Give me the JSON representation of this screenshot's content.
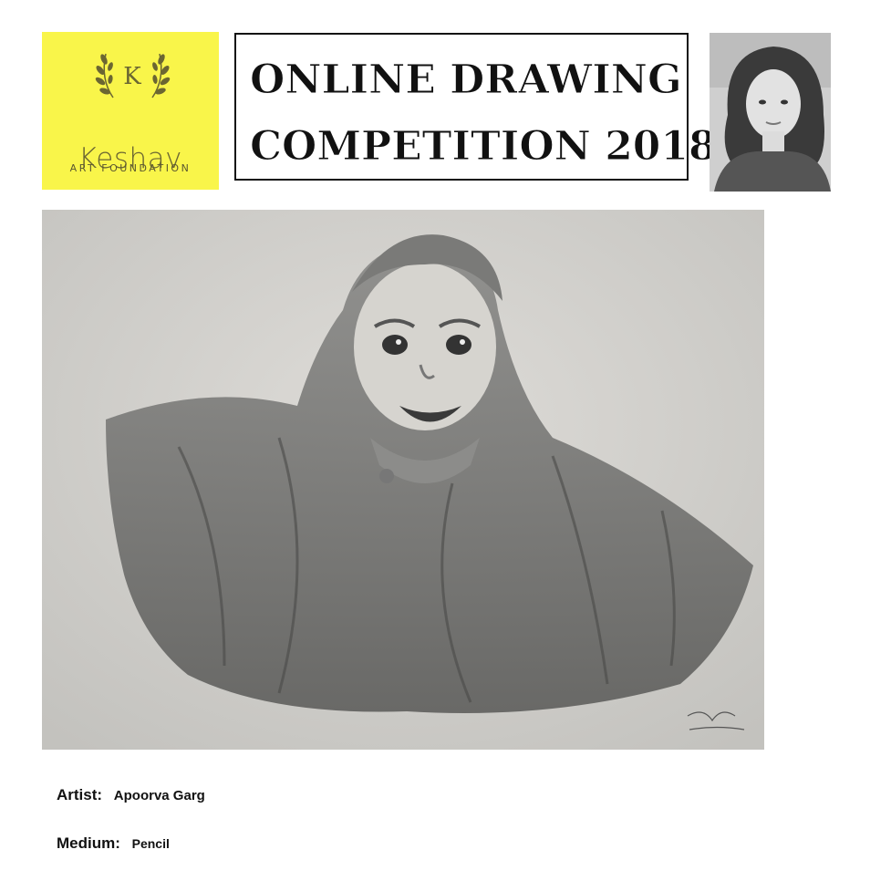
{
  "logo": {
    "monogram": "K",
    "name": "Keshav",
    "subtitle": "ART FOUNDATION",
    "background_color": "#f9f54a"
  },
  "title": {
    "line1": "ONLINE DRAWING",
    "line2": "COMPETITION 2018"
  },
  "artist_photo": {
    "icon": "artist-portrait-photo"
  },
  "artwork": {
    "icon": "pencil-drawing-baby-in-blanket",
    "signature": "love, Apoorva Garg"
  },
  "details": {
    "artist_label": "Artist:",
    "artist_value": "Apoorva Garg",
    "medium_label": "Medium:",
    "medium_value": "Pencil"
  }
}
